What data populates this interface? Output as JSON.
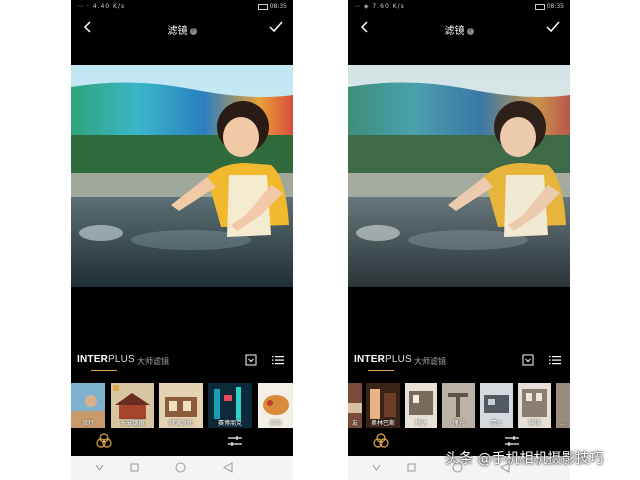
{
  "left": {
    "status": {
      "left_icons": "⋯  · 4.40 K/s",
      "right_text": "08:35"
    },
    "title": "滤镜",
    "tabs": {
      "interplus_bold": "INTER",
      "interplus_rest": "PLUS",
      "master": "大师滤镜"
    },
    "thumbnails": [
      {
        "label": "旅行"
      },
      {
        "label": "长安烟雨"
      },
      {
        "label": "桃源时代"
      },
      {
        "label": "赛博朋克"
      },
      {
        "label": "食物"
      }
    ]
  },
  "right": {
    "status": {
      "left_icons": "⋯  ◈ 7.60 K/s",
      "right_text": "08:35"
    },
    "title": "滤镜",
    "tabs": {
      "interplus_bold": "INTER",
      "interplus_rest": "PLUS",
      "master": "大师滤镜"
    },
    "thumbnails": [
      {
        "label": "友"
      },
      {
        "label": "奥林巴斯"
      },
      {
        "label": "柯达"
      },
      {
        "label": "理光"
      },
      {
        "label": "富士"
      },
      {
        "label": "宾得"
      },
      {
        "label": "…"
      }
    ]
  },
  "watermark": "头条 @手机相机摄影技巧",
  "colors": {
    "accent": "#e0a74a",
    "background": "#000000",
    "navbar": "#f4f4f4"
  },
  "icons": [
    "back-icon",
    "help-icon",
    "confirm-icon",
    "collapse-icon",
    "list-icon",
    "filter-tool-icon",
    "adjust-tool-icon",
    "nav-back-icon",
    "nav-home-icon",
    "nav-recents-icon"
  ]
}
